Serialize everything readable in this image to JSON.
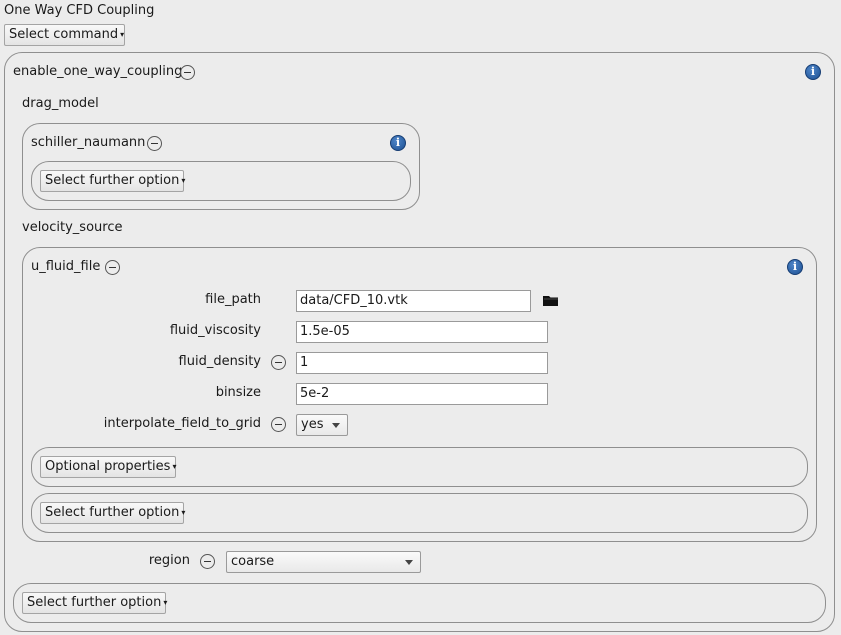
{
  "window_title": "One Way CFD Coupling",
  "select_command_label": "Select command",
  "enable": {
    "title": "enable_one_way_coupling",
    "drag_model_label": "drag_model",
    "schiller": {
      "title": "schiller_naumann",
      "further_option_label": "Select further option"
    },
    "velocity_source_label": "velocity_source",
    "u_fluid": {
      "title": "u_fluid_file",
      "file_path_label": "file_path",
      "file_path_value": "data/CFD_10.vtk",
      "fluid_viscosity_label": "fluid_viscosity",
      "fluid_viscosity_value": "1.5e-05",
      "fluid_density_label": "fluid_density",
      "fluid_density_value": "1",
      "binsize_label": "binsize",
      "binsize_value": "5e-2",
      "interpolate_label": "interpolate_field_to_grid",
      "interpolate_value": "yes",
      "optional_properties_label": "Optional properties",
      "further_option_label": "Select further option"
    },
    "region_label": "region",
    "region_value": "coarse",
    "further_option_label": "Select further option"
  },
  "icons": {
    "info": "info-icon",
    "remove": "minus-circle-icon",
    "browse": "folder-icon",
    "dropdown": "chevron-down-icon"
  },
  "info_glyph": "i"
}
